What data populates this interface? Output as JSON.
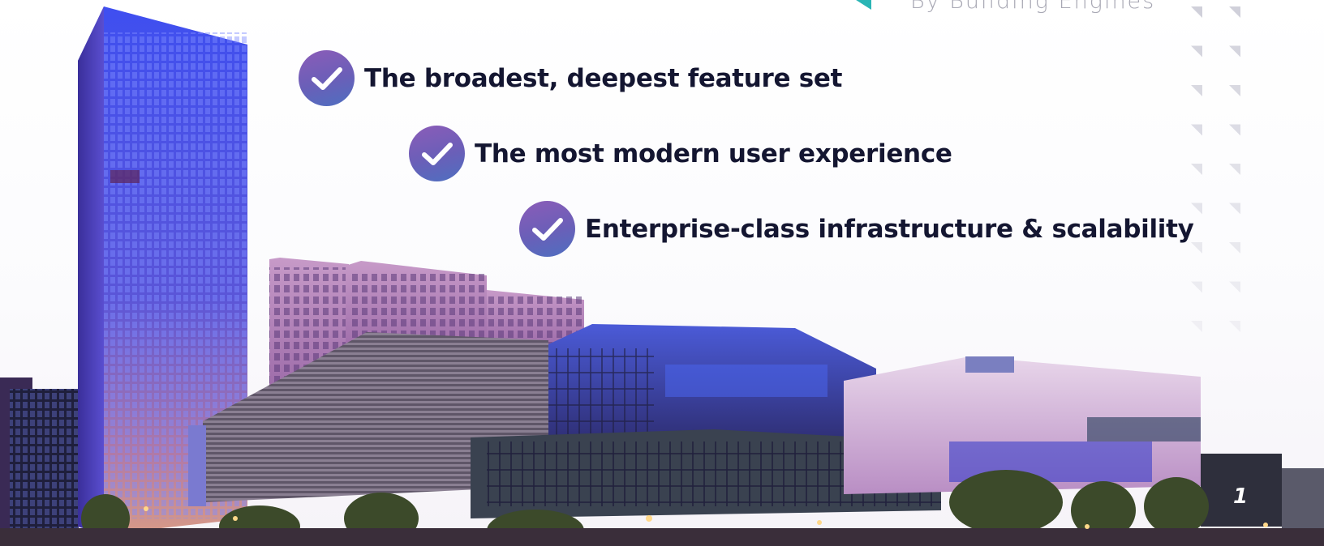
{
  "header": {
    "tagline": "By Building Engines"
  },
  "bullets": [
    {
      "text": "The broadest, deepest feature set",
      "icon": "check-icon"
    },
    {
      "text": "The most modern user experience",
      "icon": "check-icon"
    },
    {
      "text": "Enterprise-class infrastructure & scalability",
      "icon": "check-icon"
    }
  ],
  "footer": {
    "page_number": "1"
  },
  "colors": {
    "check_gradient_start": "#8b5cb8",
    "check_gradient_end": "#4e6fc0",
    "bullet_text": "#141631",
    "tagline": "#a8a8b4",
    "accent_teal": "#2ab5b5"
  }
}
